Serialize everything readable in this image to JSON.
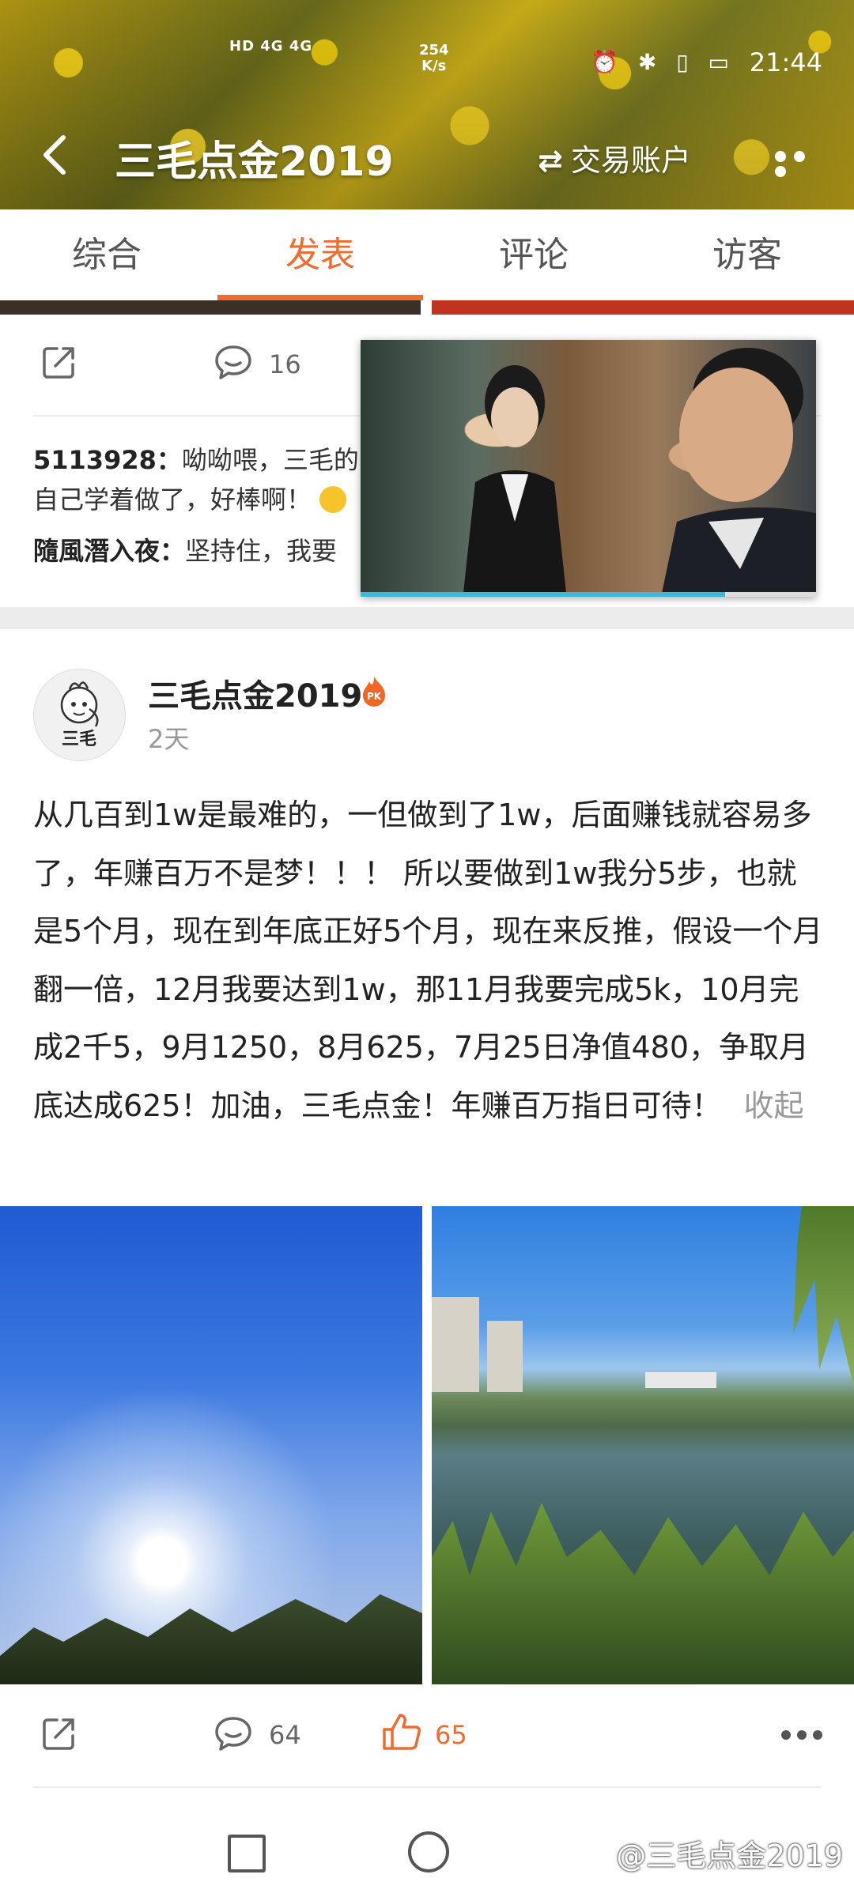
{
  "status_bar": {
    "network_left": "HD 4G 4G",
    "speed_value": "254",
    "speed_unit": "K/s",
    "time": "21:44"
  },
  "header": {
    "title": "三毛点金2019",
    "account_label": "交易账户"
  },
  "tabs": [
    {
      "label": "综合",
      "active": false
    },
    {
      "label": "发表",
      "active": true
    },
    {
      "label": "评论",
      "active": false
    },
    {
      "label": "访客",
      "active": false
    }
  ],
  "prev_post": {
    "comment_count": "16",
    "comments": [
      {
        "author": "5113928：",
        "text": "呦呦喂，三毛的"
      },
      {
        "author": "",
        "text": "自己学着做了，好棒啊！"
      },
      {
        "author": "隨風潛入夜：",
        "text": "坚持住，我要"
      }
    ]
  },
  "video": {
    "progress": 0.8
  },
  "post": {
    "author": "三毛点金2019",
    "badge": "PK",
    "time": "2天",
    "body": "从几百到1w是最难的，一但做到了1w，后面赚钱就容易多了，年赚百万不是梦！！！ 所以要做到1w我分5步，也就是5个月，现在到年底正好5个月，现在来反推，假设一个月翻一倍，12月我要达到1w，那11月我要完成5k，10月完成2千5，9月1250，8月625，7月25日净值480，争取月底达成625！加油，三毛点金！年赚百万指日可待！",
    "collapse_label": "收起",
    "comment_count": "64",
    "like_count": "65"
  },
  "avatar_text": "三毛",
  "watermark": "@三毛点金2019",
  "colors": {
    "accent": "#f06b2f",
    "badge": "#f26522"
  }
}
